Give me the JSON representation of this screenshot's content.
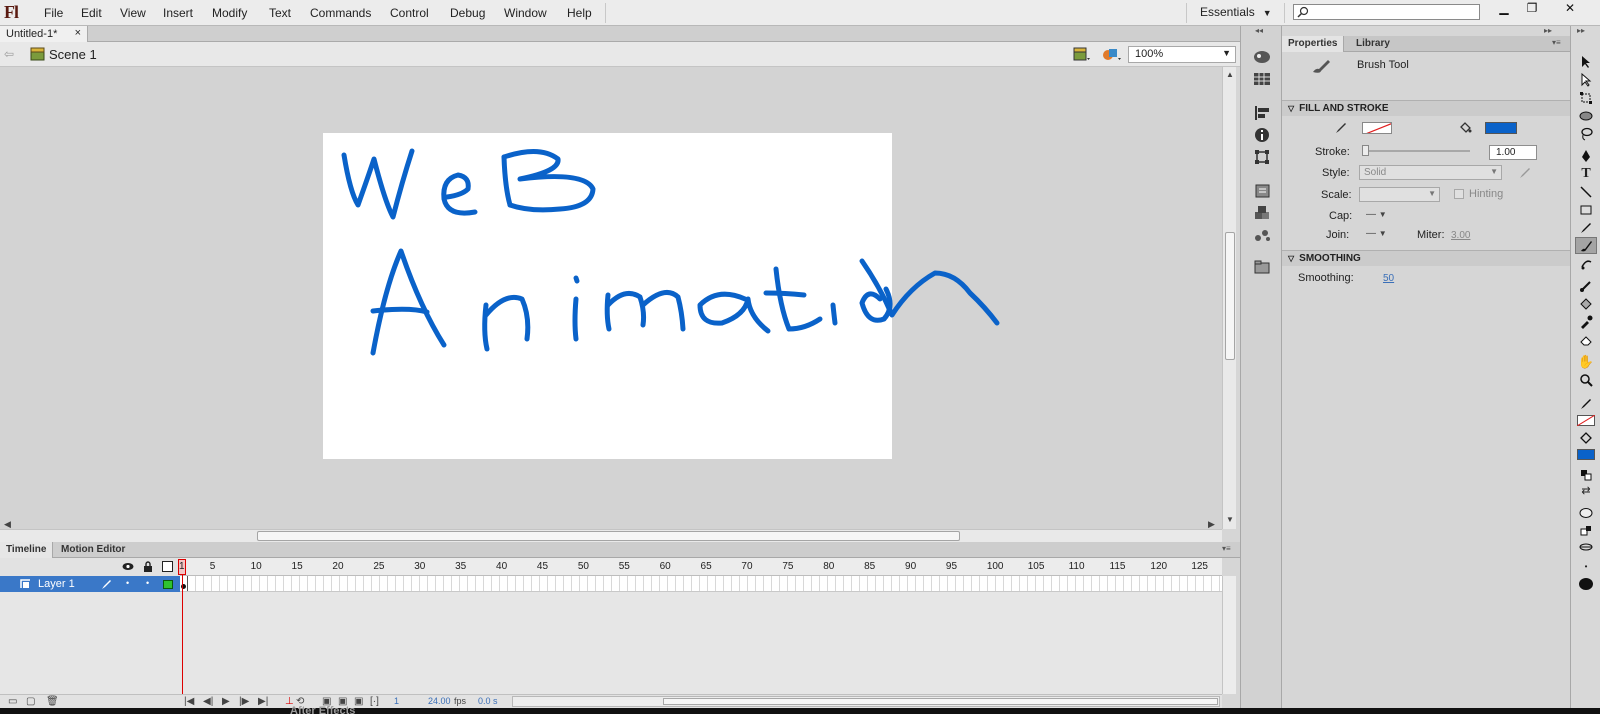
{
  "app": {
    "logo": "Fl",
    "menu": [
      "File",
      "Edit",
      "View",
      "Insert",
      "Modify",
      "Text",
      "Commands",
      "Control",
      "Debug",
      "Window",
      "Help"
    ],
    "workspace": "Essentials",
    "search_placeholder": "",
    "window_controls": [
      "minimize",
      "restore",
      "close"
    ]
  },
  "document": {
    "tab_title": "Untitled-1*",
    "tab_close": "×",
    "scene": "Scene 1",
    "zoom": "100%"
  },
  "stage": {
    "drawing_text_line1": "WeB",
    "drawing_text_line2": "Animation",
    "stroke_color": "#0a62c9",
    "background": "#ffffff"
  },
  "timeline": {
    "tabs": [
      "Timeline",
      "Motion Editor"
    ],
    "layer_name": "Layer 1",
    "frame_numbers": [
      "1",
      "5",
      "10",
      "15",
      "20",
      "25",
      "30",
      "35",
      "40",
      "45",
      "50",
      "55",
      "60",
      "65",
      "70",
      "75",
      "80",
      "85",
      "90",
      "95",
      "100",
      "105",
      "110",
      "115",
      "120",
      "125"
    ],
    "current_frame": "1",
    "fps": "24.00",
    "fps_unit": "fps",
    "time": "0.0 s"
  },
  "properties": {
    "tabs": [
      "Properties",
      "Library"
    ],
    "tool_name": "Brush Tool",
    "fill_and_stroke_header": "FILL AND STROKE",
    "stroke_label": "Stroke:",
    "stroke_value": "1.00",
    "style_label": "Style:",
    "style_value": "Solid",
    "scale_label": "Scale:",
    "hinting_label": "Hinting",
    "cap_label": "Cap:",
    "join_label": "Join:",
    "miter_label": "Miter:",
    "miter_value": "3.00",
    "smoothing_header": "SMOOTHING",
    "smoothing_label": "Smoothing:",
    "smoothing_value": "50",
    "fill_color": "#0a62c9"
  },
  "taskbar": {
    "label": "After Effects"
  }
}
